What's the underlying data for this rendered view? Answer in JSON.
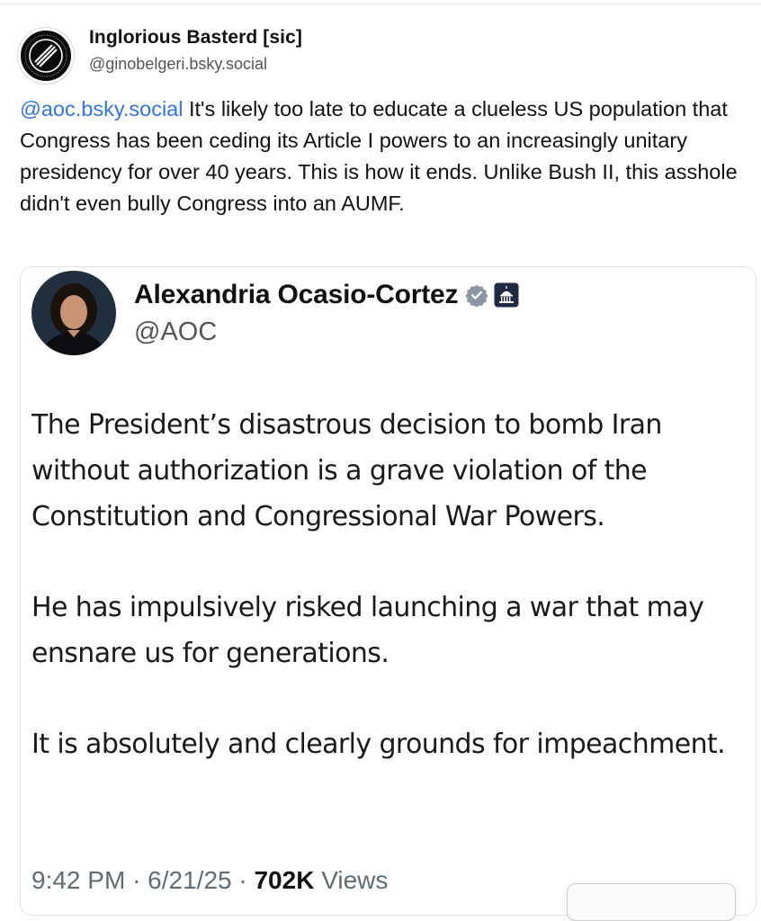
{
  "post": {
    "author_name": "Inglorious Basterd [sic]",
    "author_handle": "@ginobelgeri.bsky.social",
    "avatar_icon": "antifascist-circle-logo",
    "avatar_logo_text": "SOMETIMES ANTIFASCIST ALWAYS ANTIFASCIST",
    "mention": "@aoc.bsky.social",
    "body": " It's likely too late to educate a clueless US population that Congress has been ceding its Article I powers to an increasingly unitary presidency for over 40 years. This is how it ends. Unlike Bush II, this asshole didn't even bully Congress into an AUMF."
  },
  "quoted": {
    "author_name": "Alexandria Ocasio-Cortez",
    "author_handle": "@AOC",
    "badges": [
      "verified-badge-icon",
      "government-capitol-icon"
    ],
    "paragraphs": [
      "The President’s disastrous decision to bomb Iran without authorization is a grave violation of the Constitution and Congressional War Powers.",
      "He has impulsively risked launching a war that may ensnare us for generations.",
      "It is absolutely and clearly grounds for impeachment."
    ],
    "time": "9:42 PM",
    "separator": "·",
    "date": "6/21/25",
    "views_count": "702K",
    "views_label": "Views"
  },
  "colors": {
    "mention": "#2f74f0",
    "meta_gray": "#5f6b75",
    "verified_gray": "#8a96a3",
    "gov_badge": "#1f2a44"
  }
}
